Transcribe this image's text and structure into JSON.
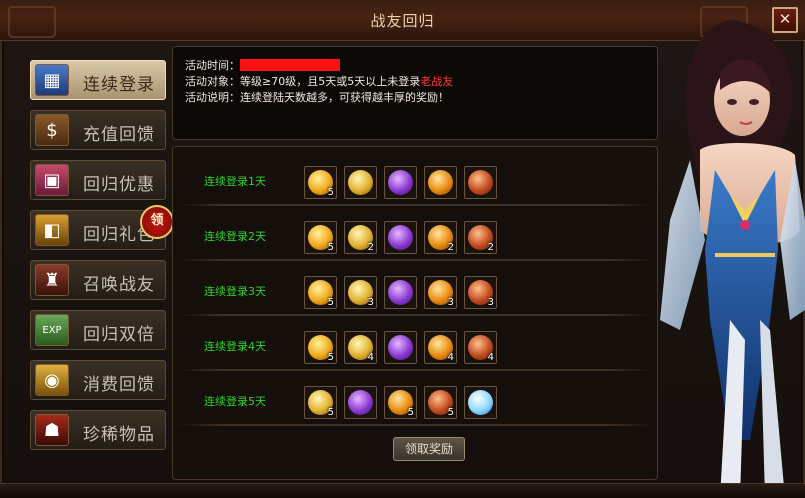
{
  "window": {
    "title": "战友回归",
    "close_glyph": "✕"
  },
  "sidebar": {
    "items": [
      {
        "label": "连续登录",
        "icon": "calendar-icon",
        "active": true
      },
      {
        "label": "充值回馈",
        "icon": "money-bag-icon",
        "active": false
      },
      {
        "label": "回归优惠",
        "icon": "gift-box-icon",
        "active": false
      },
      {
        "label": "回归礼包",
        "icon": "treasure-chest-icon",
        "active": false
      },
      {
        "label": "召唤战友",
        "icon": "armor-icon",
        "active": false
      },
      {
        "label": "回归双倍",
        "icon": "exp-scroll-icon",
        "active": false
      },
      {
        "label": "消费回馈",
        "icon": "gold-coins-icon",
        "active": false
      },
      {
        "label": "珍稀物品",
        "icon": "demon-mask-icon",
        "active": false
      }
    ],
    "claim_badge": "领"
  },
  "info": {
    "time_label": "活动时间：",
    "target_label": "活动对象：",
    "target_text": "等级≥70级，且5天或5天以上未登录",
    "target_highlight": "老战友",
    "desc_label": "活动说明：",
    "desc_text": "连续登陆天数越多，可获得越丰厚的奖励！"
  },
  "rewards": {
    "rows": [
      {
        "label": "连续登录1天",
        "items": [
          {
            "icon": "fire-coin-icon",
            "qty": "5"
          },
          {
            "icon": "gold-orb-icon",
            "qty": ""
          },
          {
            "icon": "purple-scroll-icon",
            "qty": ""
          },
          {
            "icon": "flame-orb-icon",
            "qty": ""
          },
          {
            "icon": "treasure-jar-icon",
            "qty": ""
          }
        ]
      },
      {
        "label": "连续登录2天",
        "items": [
          {
            "icon": "fire-coin-icon",
            "qty": "5"
          },
          {
            "icon": "gold-orb-icon",
            "qty": "2"
          },
          {
            "icon": "purple-gem-icon",
            "qty": ""
          },
          {
            "icon": "flame-orb-icon",
            "qty": "2"
          },
          {
            "icon": "treasure-jar-icon",
            "qty": "2"
          }
        ]
      },
      {
        "label": "连续登录3天",
        "items": [
          {
            "icon": "fire-coin-icon",
            "qty": "5"
          },
          {
            "icon": "gold-orb-icon",
            "qty": "3"
          },
          {
            "icon": "purple-scroll-icon",
            "qty": ""
          },
          {
            "icon": "flame-orb-icon",
            "qty": "3"
          },
          {
            "icon": "treasure-jar-icon",
            "qty": "3"
          }
        ]
      },
      {
        "label": "连续登录4天",
        "items": [
          {
            "icon": "fire-coin-icon",
            "qty": "5"
          },
          {
            "icon": "gold-orb-icon",
            "qty": "4"
          },
          {
            "icon": "purple-gem-icon",
            "qty": ""
          },
          {
            "icon": "flame-orb-icon",
            "qty": "4"
          },
          {
            "icon": "treasure-jar-icon",
            "qty": "4"
          }
        ]
      },
      {
        "label": "连续登录5天",
        "items": [
          {
            "icon": "gold-orb-icon",
            "qty": "5"
          },
          {
            "icon": "purple-scroll-icon",
            "qty": ""
          },
          {
            "icon": "flame-orb-icon",
            "qty": "5"
          },
          {
            "icon": "treasure-jar-icon",
            "qty": "5"
          },
          {
            "icon": "snowman-icon",
            "qty": ""
          }
        ]
      }
    ],
    "claim_button": "领取奖励"
  }
}
